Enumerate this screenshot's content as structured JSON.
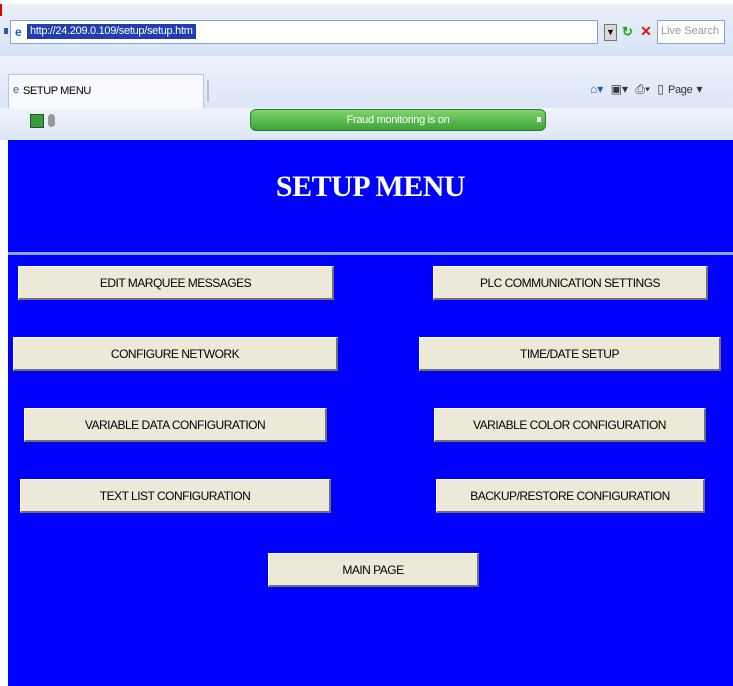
{
  "browser": {
    "url": "http://24.209.0.109/setup/setup.htm",
    "search_placeholder": "Live Search",
    "tab_title": "SETUP MENU",
    "page_menu_label": "Page",
    "info_bar_text": "Fraud monitoring is on",
    "icons": {
      "ie": "ie-page-icon",
      "go": "refresh-icon",
      "stop": "stop-icon",
      "home": "home-icon",
      "feeds": "feeds-icon",
      "print": "print-icon",
      "page": "page-icon"
    }
  },
  "page": {
    "title": "SETUP MENU",
    "background": "#0000ff",
    "buttons": {
      "edit_marquee": "EDIT MARQUEE MESSAGES",
      "plc_comm": "PLC COMMUNICATION SETTINGS",
      "configure_network": "CONFIGURE NETWORK",
      "time_date": "TIME/DATE SETUP",
      "variable_data": "VARIABLE DATA CONFIGURATION",
      "variable_color": "VARIABLE COLOR CONFIGURATION",
      "text_list": "TEXT LIST CONFIGURATION",
      "backup_restore": "BACKUP/RESTORE CONFIGURATION",
      "main_page": "MAIN PAGE"
    }
  }
}
